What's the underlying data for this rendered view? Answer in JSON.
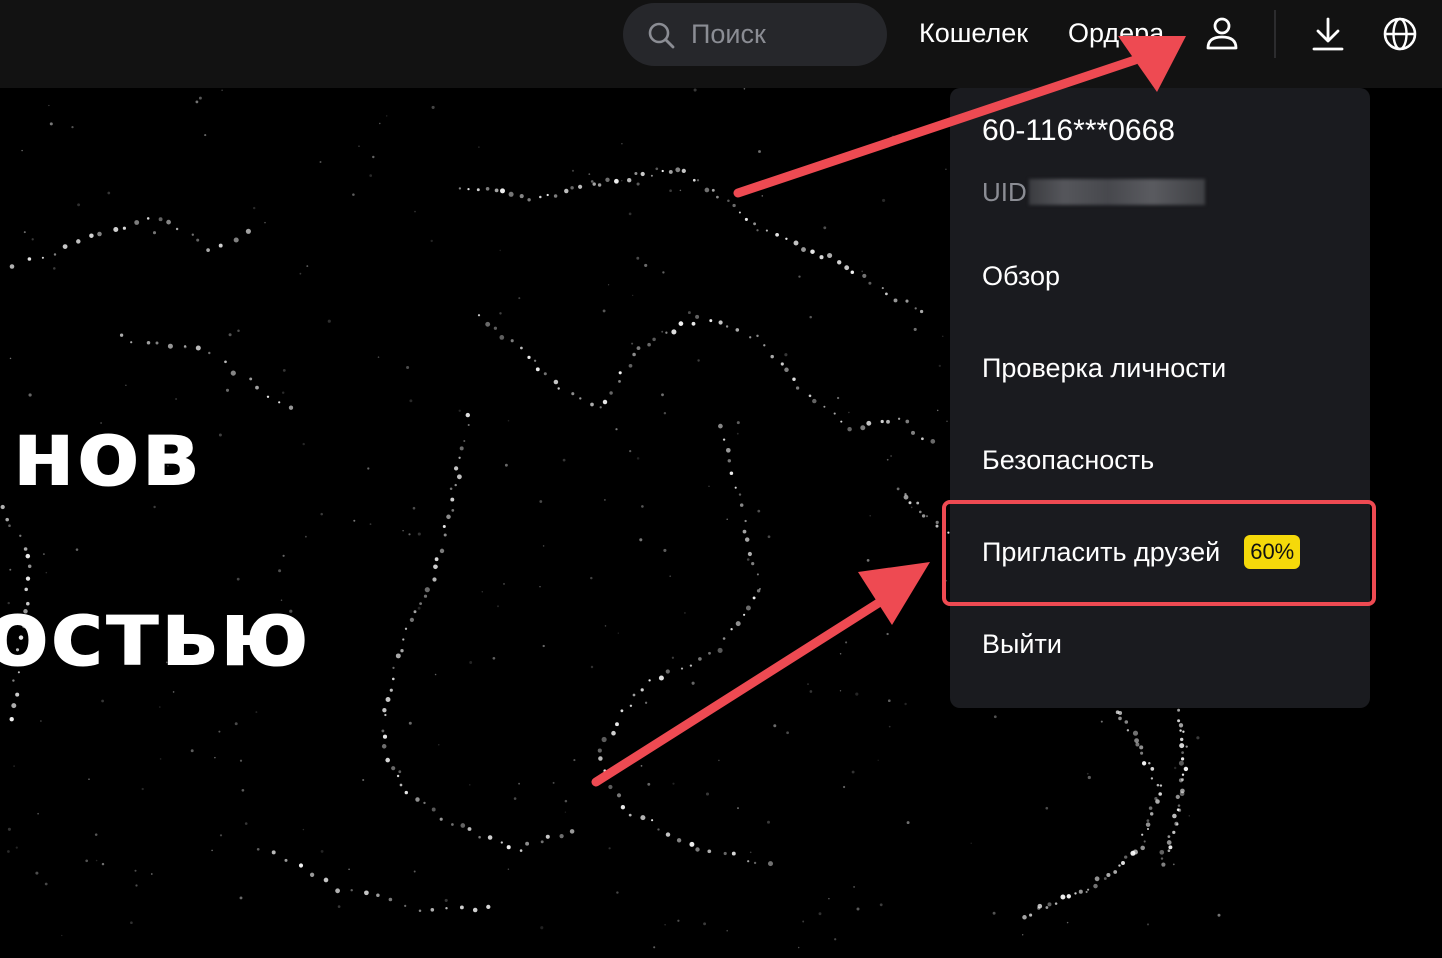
{
  "header": {
    "search": {
      "placeholder": "Поиск"
    },
    "nav": {
      "wallet": "Кошелек",
      "orders": "Ордера"
    }
  },
  "hero": {
    "line1": "нов",
    "line2": "остью"
  },
  "account_menu": {
    "phone": "60-116***0668",
    "uid_label": "UID",
    "items": [
      {
        "label": "Обзор"
      },
      {
        "label": "Проверка личности"
      },
      {
        "label": "Безопасность"
      },
      {
        "label": "Пригласить друзей",
        "badge": "60%"
      },
      {
        "label": "Выйти"
      }
    ]
  },
  "colors": {
    "topbar_bg": "#121212",
    "menu_bg": "#1a1b1f",
    "badge_bg": "#f5d90a",
    "annotation_red": "#ee4a52",
    "muted_text": "#8b8d94"
  },
  "icons": [
    "search-icon",
    "user-icon",
    "download-icon",
    "globe-icon"
  ]
}
